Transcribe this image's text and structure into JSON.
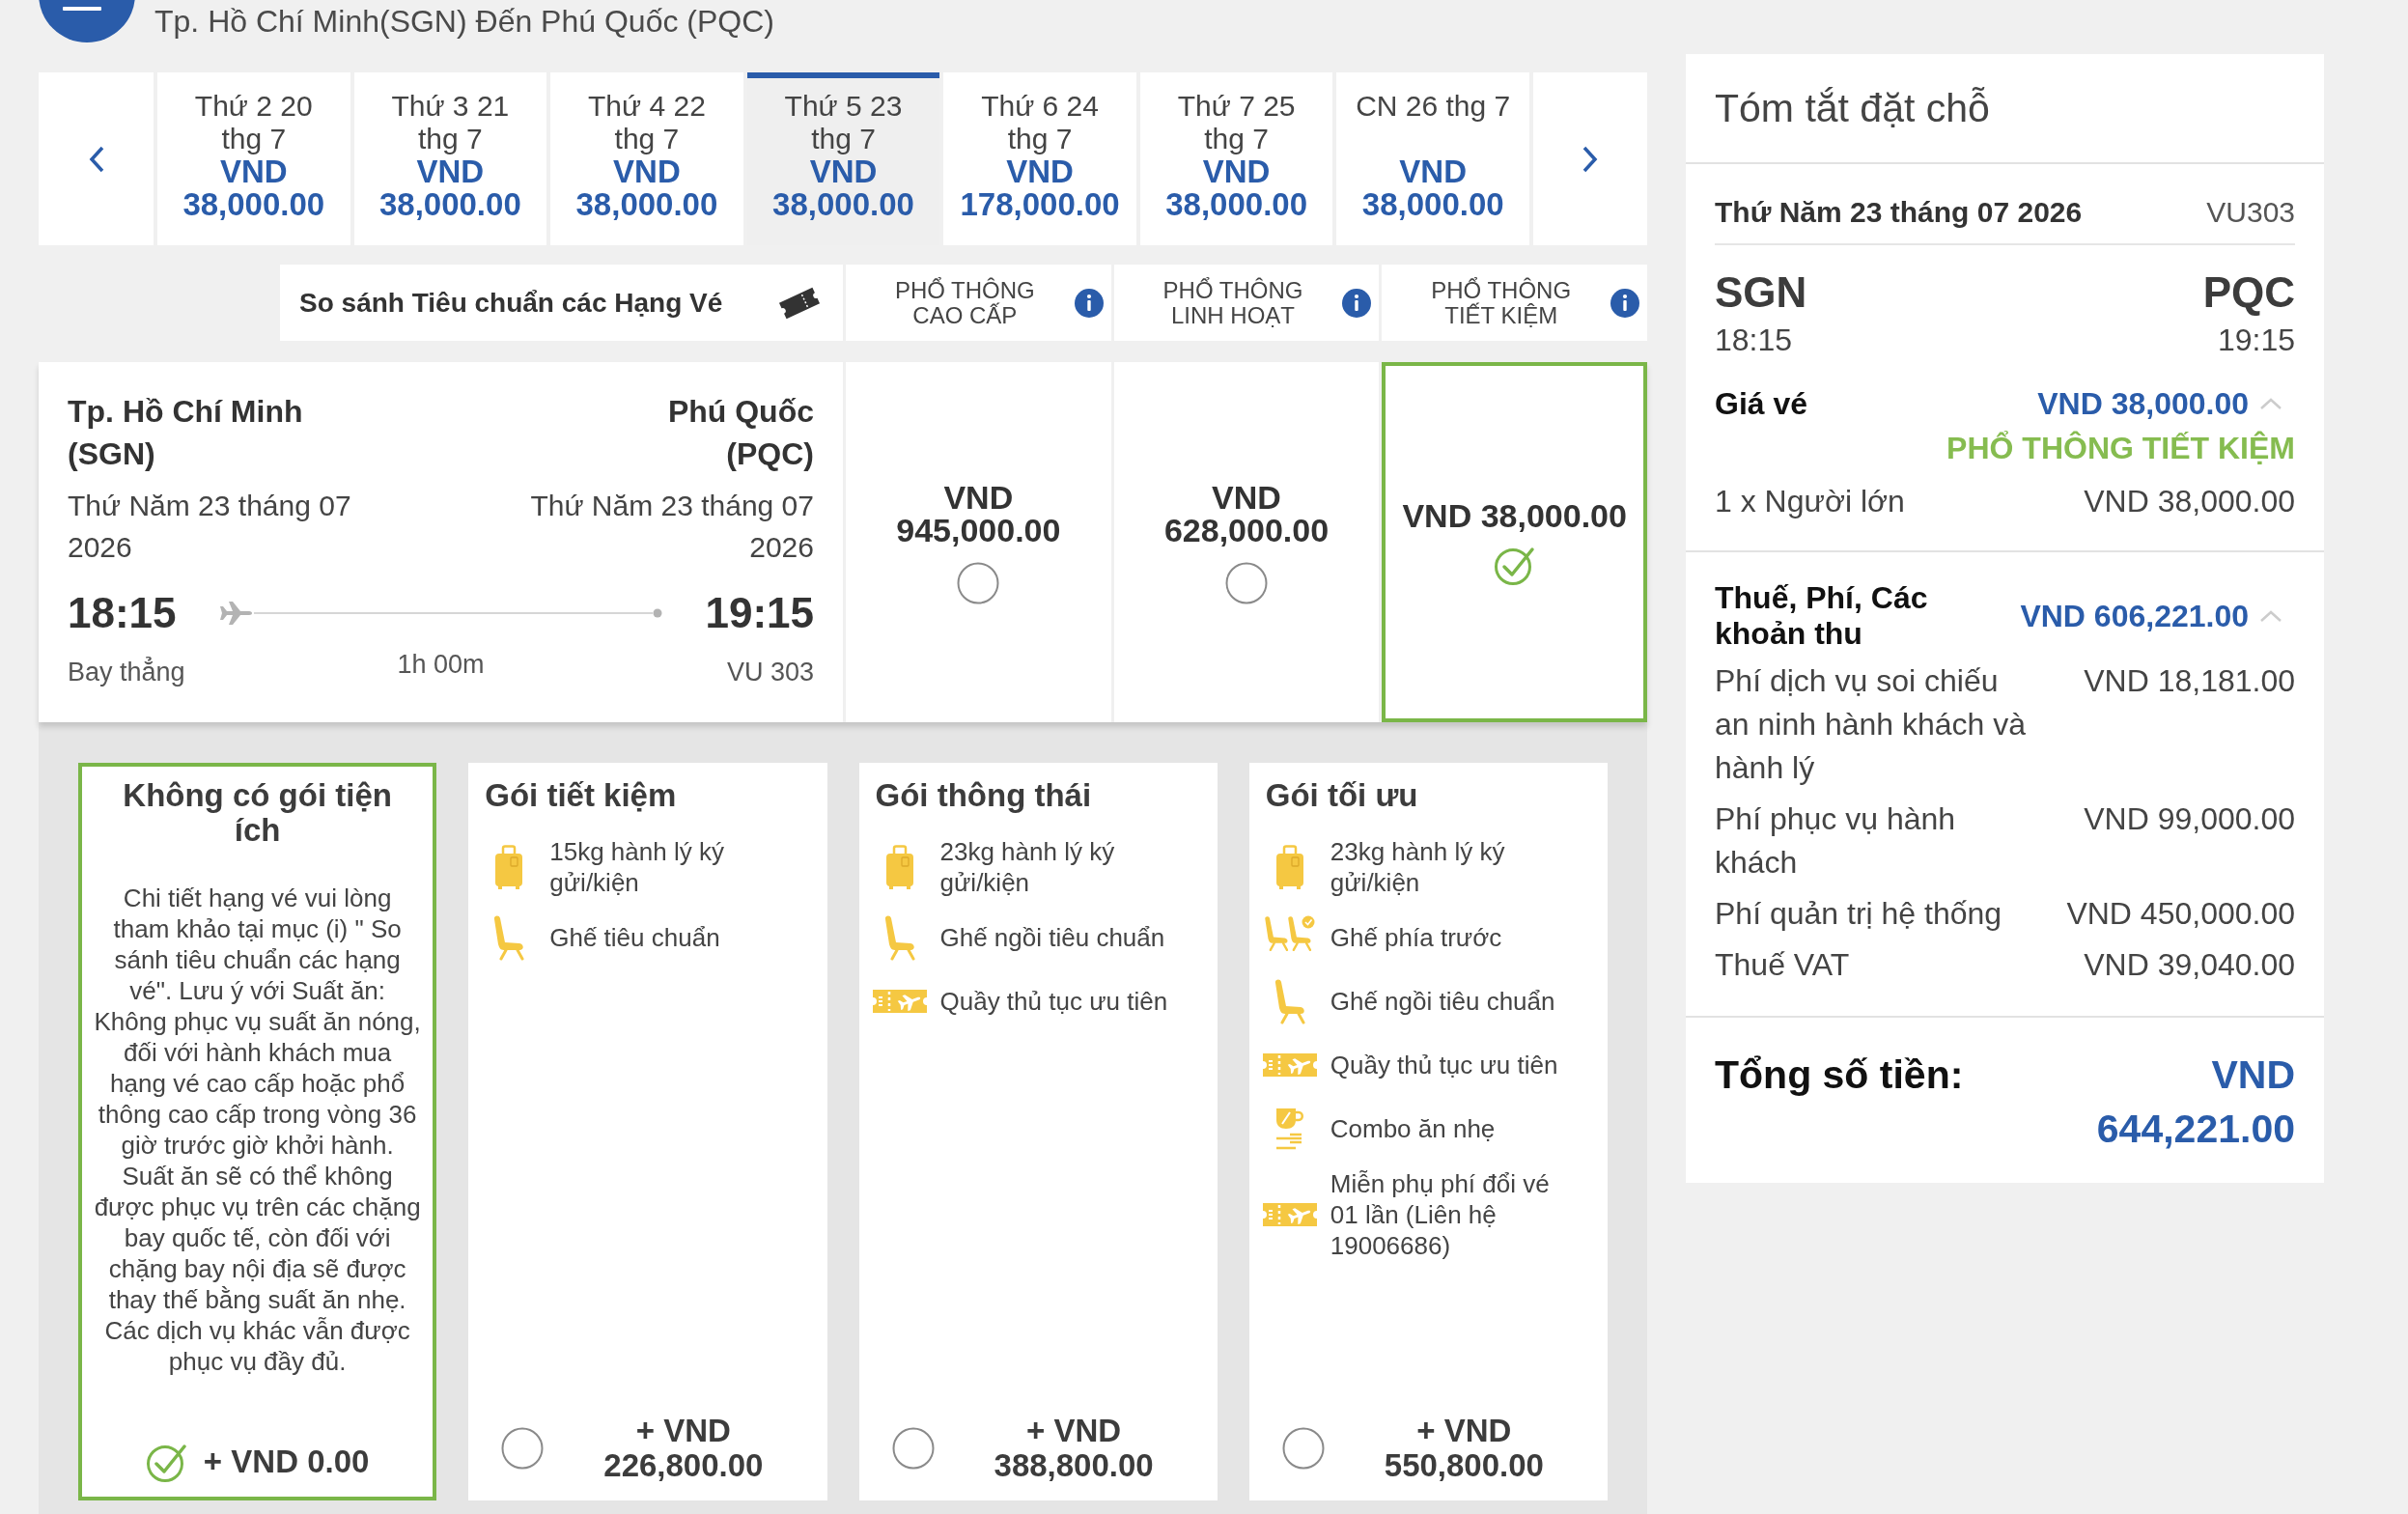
{
  "header": {
    "title": "Tp. Hồ Chí Minh(SGN) Đến Phú Quốc (PQC)"
  },
  "date_tabs": [
    {
      "date": "Thứ 2 20 thg 7",
      "price": "VND 38,000.00",
      "selected": false
    },
    {
      "date": "Thứ 3 21 thg 7",
      "price": "VND 38,000.00",
      "selected": false
    },
    {
      "date": "Thứ 4 22 thg 7",
      "price": "VND 38,000.00",
      "selected": false
    },
    {
      "date": "Thứ 5 23 thg 7",
      "price": "VND 38,000.00",
      "selected": true
    },
    {
      "date": "Thứ 6 24 thg 7",
      "price": "VND 178,000.00",
      "selected": false
    },
    {
      "date": "Thứ 7 25 thg 7",
      "price": "VND 38,000.00",
      "selected": false
    },
    {
      "date": "CN 26 thg 7",
      "price": "VND 38,000.00",
      "selected": false
    }
  ],
  "fare_compare": {
    "label": "So sánh Tiêu chuẩn các Hạng Vé"
  },
  "flight": {
    "origin": {
      "city": "Tp. Hồ Chí Minh",
      "code": "(SGN)",
      "date": "Thứ Năm 23 tháng 07 2026",
      "time": "18:15"
    },
    "destination": {
      "city": "Phú Quốc",
      "code": "(PQC)",
      "date": "Thứ Năm 23 tháng 07 2026",
      "time": "19:15"
    },
    "stops": "Bay thẳng",
    "duration": "1h 00m",
    "flight_number": "VU 303"
  },
  "fares": [
    {
      "class": "PHỔ THÔNG CAO CẤP",
      "price": "VND 945,000.00",
      "selected": false
    },
    {
      "class": "PHỔ THÔNG LINH HOẠT",
      "price": "VND 628,000.00",
      "selected": false
    },
    {
      "class": "PHỔ THÔNG TIẾT KIỆM",
      "price": "VND 38,000.00",
      "selected": true
    }
  ],
  "packages": [
    {
      "kind": "note",
      "title": "Không có gói tiện ích",
      "note": "Chi tiết hạng vé vui lòng tham khảo tại mục (i) \" So sánh tiêu chuẩn các hạng vé\". Lưu ý với Suất ăn: Không phục vụ suất ăn nóng, đối với hành khách mua hạng vé cao cấp hoặc phổ thông cao cấp trong vòng 36 giờ trước giờ khởi hành. Suất ăn sẽ có thể không được phục vụ trên các chặng bay quốc tế, còn đối với chặng bay nội địa sẽ được thay thế bằng suất ăn nhẹ. Các dịch vụ khác vẫn được phục vụ đầy đủ.",
      "price": "+ VND 0.00",
      "selected": true
    },
    {
      "kind": "features",
      "title": "Gói tiết kiệm",
      "features": [
        {
          "kind": "baggage",
          "text": "15kg hành lý ký gửi/kiện"
        },
        {
          "kind": "seat",
          "text": "Ghế tiêu chuẩn"
        }
      ],
      "price": "+ VND 226,800.00",
      "selected": false
    },
    {
      "kind": "features",
      "title": "Gói thông thái",
      "features": [
        {
          "kind": "baggage",
          "text": "23kg hành lý ký gửi/kiện"
        },
        {
          "kind": "seat",
          "text": "Ghế ngồi tiêu chuẩn"
        },
        {
          "kind": "ticket",
          "text": "Quầy thủ tục ưu tiên"
        }
      ],
      "price": "+ VND 388,800.00",
      "selected": false
    },
    {
      "kind": "features",
      "title": "Gói tối ưu",
      "features": [
        {
          "kind": "baggage",
          "text": "23kg hành lý ký gửi/kiện"
        },
        {
          "kind": "seats",
          "text": "Ghế phía trước"
        },
        {
          "kind": "seat",
          "text": "Ghế ngồi tiêu chuẩn"
        },
        {
          "kind": "ticket",
          "text": "Quầy thủ tục ưu tiên"
        },
        {
          "kind": "meal",
          "text": "Combo ăn nhẹ"
        },
        {
          "kind": "ticket",
          "text": "Miễn phụ phí đổi vé 01 lần (Liên hệ 19006686)"
        }
      ],
      "price": "+ VND 550,800.00",
      "selected": false
    }
  ],
  "summary": {
    "title": "Tóm tắt đặt chỗ",
    "date": "Thứ Năm 23 tháng 07 2026",
    "flight_number": "VU303",
    "origin": {
      "code": "SGN",
      "time": "18:15"
    },
    "destination": {
      "code": "PQC",
      "time": "19:15"
    },
    "fare": {
      "label": "Giá vé",
      "amount": "VND 38,000.00",
      "expanded": true,
      "fare_class": "PHỔ THÔNG TIẾT KIỆM",
      "lines": [
        {
          "label": "1 x Người lớn",
          "amount": "VND 38,000.00"
        }
      ]
    },
    "taxes": {
      "label": "Thuế, Phí, Các khoản thu",
      "amount": "VND 606,221.00",
      "expanded": true,
      "lines": [
        {
          "label": "Phí dịch vụ soi chiếu an ninh hành khách và hành lý",
          "amount": "VND 18,181.00"
        },
        {
          "label": "Phí phục vụ hành khách",
          "amount": "VND 99,000.00"
        },
        {
          "label": "Phí quản trị hệ thống",
          "amount": "VND 450,000.00"
        },
        {
          "label": "Thuế VAT",
          "amount": "VND 39,040.00"
        }
      ]
    },
    "total": {
      "label": "Tổng số tiền:",
      "amount": "VND 644,221.00"
    }
  }
}
